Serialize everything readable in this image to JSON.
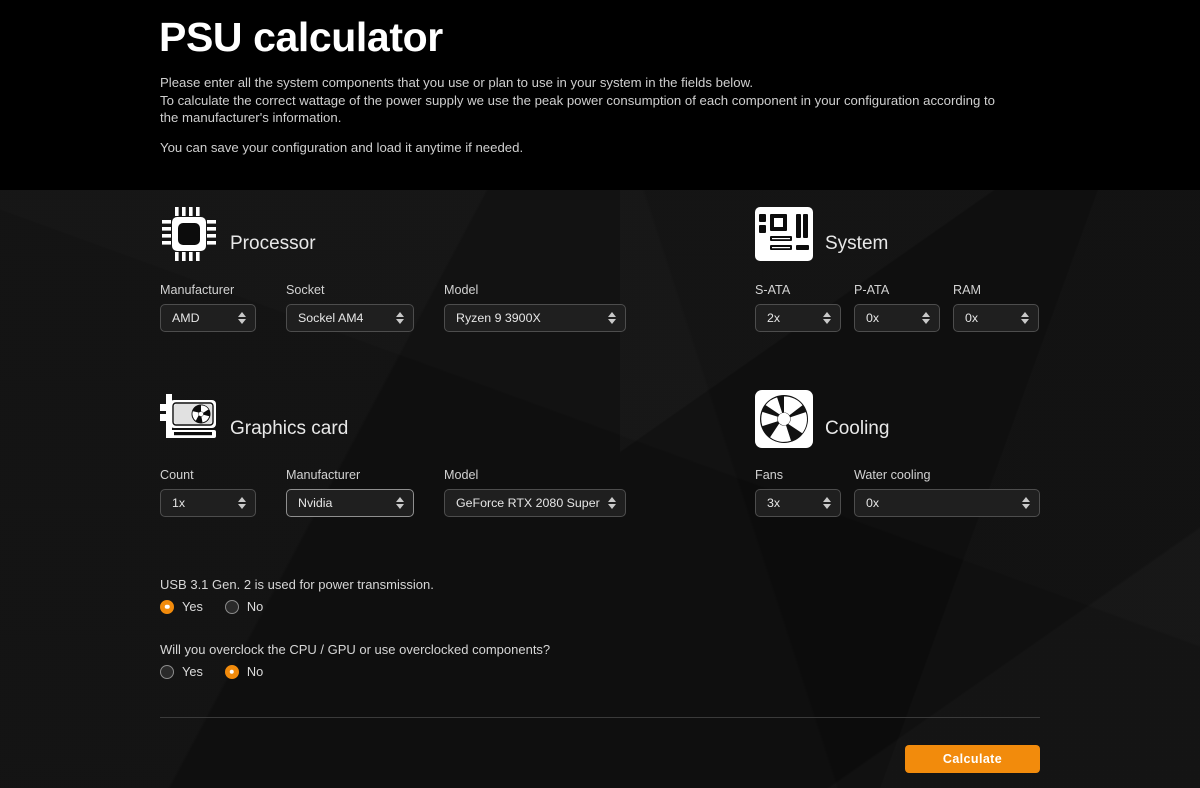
{
  "header": {
    "title": "PSU calculator",
    "intro_line1": "Please enter all the system components that you use or plan to use in your system in the fields below.",
    "intro_line2": "To calculate the correct wattage of the power supply we use the peak power consumption of each component in your configuration according to the manufacturer's information.",
    "intro_line3": "You can save your configuration and load it anytime if needed."
  },
  "sections": {
    "processor": {
      "title": "Processor",
      "icon": "cpu-chip-icon",
      "fields": [
        {
          "label": "Manufacturer",
          "value": "AMD",
          "width": 96
        },
        {
          "label": "Socket",
          "value": "Sockel AM4",
          "width": 128
        },
        {
          "label": "Model",
          "value": "Ryzen 9 3900X",
          "width": 182
        }
      ]
    },
    "system": {
      "title": "System",
      "icon": "motherboard-icon",
      "fields": [
        {
          "label": "S-ATA",
          "value": "2x",
          "width": 86
        },
        {
          "label": "P-ATA",
          "value": "0x",
          "width": 86
        },
        {
          "label": "RAM",
          "value": "0x",
          "width": 86
        }
      ]
    },
    "graphics": {
      "title": "Graphics card",
      "icon": "graphics-card-icon",
      "fields": [
        {
          "label": "Count",
          "value": "1x",
          "width": 96
        },
        {
          "label": "Manufacturer",
          "value": "Nvidia",
          "width": 128
        },
        {
          "label": "Model",
          "value": "GeForce RTX 2080 Super",
          "width": 182
        }
      ]
    },
    "cooling": {
      "title": "Cooling",
      "icon": "fan-icon",
      "fields": [
        {
          "label": "Fans",
          "value": "3x",
          "width": 86
        },
        {
          "label": "Water cooling",
          "value": "0x",
          "width": 186
        }
      ]
    }
  },
  "questions": [
    {
      "text": "USB 3.1 Gen. 2 is used for power transmission.",
      "options": [
        {
          "label": "Yes",
          "selected": true
        },
        {
          "label": "No",
          "selected": false
        }
      ]
    },
    {
      "text": "Will you overclock the CPU / GPU or use overclocked components?",
      "options": [
        {
          "label": "Yes",
          "selected": false
        },
        {
          "label": "No",
          "selected": true
        }
      ]
    }
  ],
  "actions": {
    "calculate_label": "Calculate"
  },
  "colors": {
    "accent": "#f28b0c",
    "background": "#0c0c0c",
    "header_background": "#000000",
    "field_background": "#1f1f1f",
    "field_border": "#4d4d4d"
  }
}
